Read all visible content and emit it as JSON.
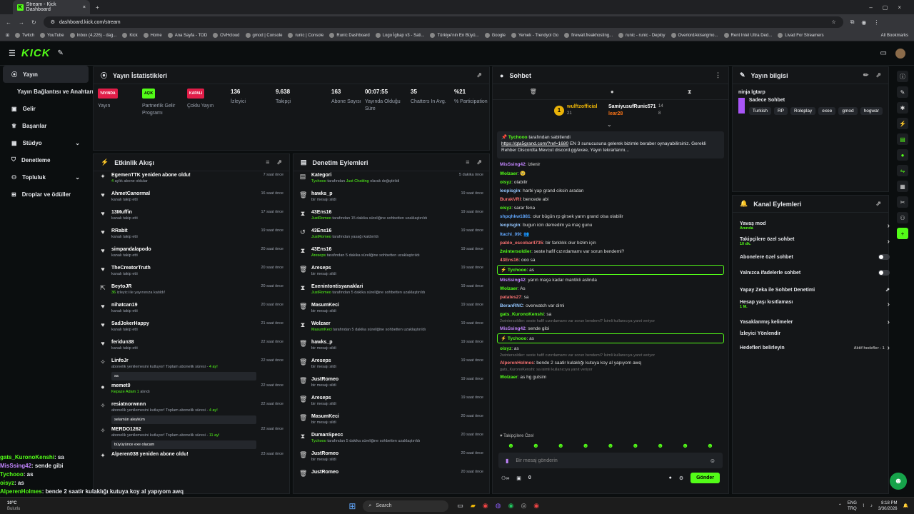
{
  "browser": {
    "tab_title": "Stream - Kick Dashboard",
    "url": "dashboard.kick.com/stream",
    "bookmarks": [
      "Twitch",
      "YouTube",
      "Inbox (4,226) - dag...",
      "Kick",
      "Home",
      "Ana Sayfa - TOD",
      "OVHcloud",
      "gmod | Console",
      "runic | Console",
      "Runic Dashboard",
      "Logo İgbap v3 - Sati...",
      "Türkiye'nin En Büyü...",
      "Google",
      "Yemek - Trendyol Go",
      "firewall.freakhosting...",
      "runic - runic - Deploy",
      "OverlordAkise/gmo...",
      "Rent Intel Ultra Ded...",
      "Livad For Streamers"
    ],
    "all_bookmarks": "All Bookmarks"
  },
  "sidebar": {
    "items": [
      {
        "label": "Yayın"
      },
      {
        "label": "Yayın Bağlantısı ve Anahtarı"
      },
      {
        "label": "Gelir"
      },
      {
        "label": "Başarılar"
      },
      {
        "label": "Stüdyo"
      },
      {
        "label": "Denetleme"
      },
      {
        "label": "Topluluk"
      },
      {
        "label": "Droplar ve ödüller"
      }
    ]
  },
  "stats": {
    "title": "Yayın İstatistikleri",
    "items": [
      {
        "badge": "YAYINDA",
        "label": "Yayın",
        "color": "#e11d48"
      },
      {
        "badge": "AÇIK",
        "label": "Partnerlik Gelir Programı",
        "color": "#53fc18"
      },
      {
        "badge": "KAPALI",
        "label": "Çoklu Yayın",
        "color": "#e11d48"
      },
      {
        "value": "136",
        "label": "İzleyici"
      },
      {
        "value": "9.638",
        "label": "Takipçi"
      },
      {
        "value": "163",
        "label": "Abone Sayısı"
      },
      {
        "value": "00:07:55",
        "label": "Yayında Olduğu Süre"
      },
      {
        "value": "35",
        "label": "Chatters In Avg."
      },
      {
        "value": "%21",
        "label": "% Participation"
      }
    ]
  },
  "activity": {
    "title": "Etkinlik Akışı",
    "items": [
      {
        "icon": "✦",
        "title": "EgemenTTK yeniden abone oldu!",
        "sub_g": "4",
        "sub": " aylık abone oldular",
        "time": "7 saat önce"
      },
      {
        "icon": "♥",
        "title": "AhmetCanormal",
        "sub": "kanalı takip etti",
        "time": "16 saat önce"
      },
      {
        "icon": "♥",
        "title": "13Muffin",
        "sub": "kanalı takip etti",
        "time": "17 saat önce"
      },
      {
        "icon": "♥",
        "title": "RRabit",
        "sub": "kanalı takip etti",
        "time": "19 saat önce"
      },
      {
        "icon": "♥",
        "title": "simpandalapodo",
        "sub": "kanalı takip etti",
        "time": "20 saat önce"
      },
      {
        "icon": "♥",
        "title": "TheCreatorTruth",
        "sub": "kanalı takip etti",
        "time": "20 saat önce"
      },
      {
        "icon": "⇱",
        "title": "BeytoJR",
        "sub_g": "36",
        "sub": " izleyici ile yayınınıza katıldı!",
        "time": "20 saat önce"
      },
      {
        "icon": "♥",
        "title": "nihatcan19",
        "sub": "kanalı takip etti",
        "time": "20 saat önce"
      },
      {
        "icon": "♥",
        "title": "SadJokerHappy",
        "sub": "kanalı takip etti",
        "time": "21 saat önce"
      },
      {
        "icon": "♥",
        "title": "feridun38",
        "sub": "kanalı takip etti",
        "time": "22 saat önce"
      },
      {
        "icon": "✧",
        "title": "LinfoJr",
        "sub": "abonelik yenilemesini kutluyor! Toplam abonelik süresi - ",
        "sub_g2": "4 ay!",
        "quote": "sa",
        "time": "22 saat önce"
      },
      {
        "icon": "●",
        "title": "memet0",
        "sub_g": "Kepaze Adam 1",
        "sub": " alındı",
        "time": "22 saat önce"
      },
      {
        "icon": "✧",
        "title": "resiatnorwnnn",
        "sub": "abonelik yenilemesini kutluyor! Toplam abonelik süresi - ",
        "sub_g2": "4 ay!",
        "quote": "selamün aleyküm",
        "time": "22 saat önce"
      },
      {
        "icon": "✧",
        "title": "MERDO1262",
        "sub": "abonelik yenilemesini kutluyor! Toplam abonelik süresi - ",
        "sub_g2": "11 ay!",
        "quote": "büyüyünce exe olacam",
        "time": "22 saat önce"
      },
      {
        "icon": "✦",
        "title": "Alperen038 yeniden abone oldu!",
        "sub": "",
        "time": "23 saat önce"
      }
    ]
  },
  "mod": {
    "title": "Denetim Eylemleri",
    "items": [
      {
        "icon": "▤",
        "title": "Kategori",
        "sub_g": "Tychooo",
        "sub": " tarafından ",
        "sub_g2": "Just Chatting",
        "sub3": " olarak değiştirildi",
        "time": "5 dakika önce"
      },
      {
        "icon": "🗑",
        "title": "hawks_p",
        "sub": "bir mesajı sildi",
        "time": "19 saat önce"
      },
      {
        "icon": "⧗",
        "title": "43Ens16",
        "sub_g": "JustRomeo",
        "sub": " tarafından 15 dakika süreliğine sohbetten uzaklaştırıldı",
        "time": "19 saat önce"
      },
      {
        "icon": "↺",
        "title": "43Ens16",
        "sub_g": "JustRomeo",
        "sub": " tarafından yasağı kaldırıldı",
        "time": "19 saat önce"
      },
      {
        "icon": "⧗",
        "title": "43Ens16",
        "sub_g": "Areseps",
        "sub": " tarafından 5 dakika süreliğine sohbetten uzaklaştırıldı",
        "time": "19 saat önce"
      },
      {
        "icon": "🗑",
        "title": "Areseps",
        "sub": "bir mesajı sildi",
        "time": "19 saat önce"
      },
      {
        "icon": "⧗",
        "title": "Exenintontisyanaklari",
        "sub_g": "JustRomeo",
        "sub": " tarafından 5 dakika süreliğine sohbetten uzaklaştırıldı",
        "time": "19 saat önce"
      },
      {
        "icon": "🗑",
        "title": "MasumKeci",
        "sub": "bir mesajı sildi",
        "time": "19 saat önce"
      },
      {
        "icon": "⧗",
        "title": "Wolzaer",
        "sub_g": "MasumKeci",
        "sub": " tarafından 5 dakika süreliğine sohbetten uzaklaştırıldı",
        "time": "19 saat önce"
      },
      {
        "icon": "🗑",
        "title": "hawks_p",
        "sub": "bir mesajı sildi",
        "time": "19 saat önce"
      },
      {
        "icon": "🗑",
        "title": "Areseps",
        "sub": "bir mesajı sildi",
        "time": "19 saat önce"
      },
      {
        "icon": "🗑",
        "title": "JustRomeo",
        "sub": "bir mesajı sildi",
        "time": "19 saat önce"
      },
      {
        "icon": "🗑",
        "title": "Areseps",
        "sub": "bir mesajı sildi",
        "time": "19 saat önce"
      },
      {
        "icon": "🗑",
        "title": "MasumKeci",
        "sub": "bir mesajı sildi",
        "time": "20 saat önce"
      },
      {
        "icon": "⧗",
        "title": "DumanSpecc",
        "sub_g": "Tychooo",
        "sub": " tarafından 5 dakika süreliğine sohbetten uzaklaştırıldı",
        "time": "20 saat önce"
      },
      {
        "icon": "🗑",
        "title": "JustRomeo",
        "sub": "bir mesajı sildi",
        "time": "20 saat önce"
      },
      {
        "icon": "🗑",
        "title": "JustRomeo",
        "sub": "",
        "time": "20 saat önce"
      }
    ]
  },
  "chat": {
    "title": "Sohbet",
    "gifter1": {
      "name": "wulftzofficial",
      "count": "21"
    },
    "gifter2": {
      "name": "SamiyusufRunic571",
      "count": "14"
    },
    "gifter3": {
      "name": "lear28",
      "count": "8"
    },
    "pinned_by": "Tychooo",
    "pinned_by_suffix": " tarafından sabitlendi",
    "pinned_link": "https://gta5grand.com/?ref=1680",
    "pinned_text": " EN 3 sunucusuna gelerek bizimle beraber oynayabilirsiniz. Gerekli Rehber Discordta Mevcut discord.gg/exee, Yayın tekrarlarını...",
    "messages": [
      {
        "name": "MisSsing42",
        "color": "#c084fc",
        "text": ": izlenir"
      },
      {
        "name": "Wolzaer",
        "color": "#53fc18",
        "text": ": 🥺"
      },
      {
        "name": "oisyz",
        "color": "#53fc18",
        "text": ": olabilir"
      },
      {
        "name": "leopisgin",
        "color": "#93c5fd",
        "text": ": harbi yap grand ciksin aradan"
      },
      {
        "name": "BurakVRI",
        "color": "#f87171",
        "text": ": bencede abi"
      },
      {
        "name": "oisyz",
        "color": "#53fc18",
        "text": ": sarar fena"
      },
      {
        "name": "shpqhkw1881",
        "color": "#60a5fa",
        "text": ": olur bügün rp girsek yarın grand olsa olabilir"
      },
      {
        "name": "leopisgin",
        "color": "#93c5fd",
        "text": ": bugun icin demedim ya maç gunu"
      },
      {
        "name": "Itachi_09I",
        "color": "#60a5fa",
        "text": ": 👥"
      },
      {
        "name": "pablo_escobar4735",
        "color": "#f87171",
        "text": ": bir farklılık olur bizim için"
      },
      {
        "name": "2wintersoldier",
        "color": "#53fc18",
        "text": ": seste hafif cızırdamamı var sorun bendemi?"
      },
      {
        "name": "43Ens16",
        "color": "#f87171",
        "text": ": ooo sa"
      },
      {
        "name": "Tychooo",
        "color": "#53fc18",
        "text": ": as",
        "hl": true
      },
      {
        "name": "MisSsing42",
        "color": "#c084fc",
        "text": ": yarın maça kadar mantikli aslinda"
      },
      {
        "name": "Wolzaer",
        "color": "#53fc18",
        "text": ": As"
      },
      {
        "name": "patates27",
        "color": "#f87171",
        "text": ": sa"
      },
      {
        "name": "BeranRNC",
        "color": "#93c5fd",
        "text": ": overwatch var dimi"
      },
      {
        "name": "gats_KuronoKenshi",
        "color": "#53fc18",
        "text": ": sa"
      },
      {
        "reply": "2wintersoldier: seste hafif cızırdamamı var sorun bendemi? İsimli kullanıcıya yanıt veriyor",
        "name": "MisSsing42",
        "color": "#c084fc",
        "text": ": sende gibi"
      },
      {
        "name": "Tychooo",
        "color": "#53fc18",
        "text": ": as",
        "hl": true
      },
      {
        "name": "oisyz",
        "color": "#53fc18",
        "text": ": as"
      },
      {
        "reply": "2wintersoldier: seste hafif cızırdamamı var sorun bendemi? İsimli kullanıcıya yanıt veriyor",
        "name": "AlperenHolmes",
        "color": "#f87171",
        "text": ": bende 2 saatir kulaklığı kutuya koy al yapıyom awq"
      },
      {
        "reply": "gats_KuronoKenshi: sa isimli kullanıcıya yanıt veriyor",
        "name": "Wolzaer",
        "color": "#53fc18",
        "text": ": as hg gutsim"
      }
    ],
    "followers_only": "Takipçilere Özel",
    "input_placeholder": "Bir mesaj gönderin",
    "points": "0",
    "send": "Gönder"
  },
  "stream_info": {
    "title": "Yayın bilgisi",
    "stream_title": "ninja lgtarp",
    "category": "Sadece Sohbet",
    "tags": [
      "Turkish",
      "RP",
      "Roleplay",
      "exee",
      "gmod",
      "hogwar"
    ]
  },
  "actions": {
    "title": "Kanal Eylemleri",
    "items": [
      {
        "label": "Yavaş mod",
        "sub": "Anında",
        "kind": "chev"
      },
      {
        "label": "Takipçilere özel sohbet",
        "sub": "10 dk.",
        "kind": "chev"
      },
      {
        "label": "Abonelere özel sohbet",
        "kind": "toggle"
      },
      {
        "label": "Yalnızca ifadelerle sohbet",
        "kind": "toggle"
      },
      {
        "label": "Yapay Zeka ile Sohbet Denetimi",
        "kind": "ext"
      },
      {
        "label": "Hesap yaşı kısıtlaması",
        "sub": "1 M.",
        "kind": "chev"
      },
      {
        "label": "Yasaklanmış kelimeler",
        "kind": "chev"
      },
      {
        "label": "İzleyici Yönlendir",
        "kind": "none"
      },
      {
        "label": "Hedefleri belirleyin",
        "kind": "goal",
        "extra": "Aktif hedefler - 1"
      }
    ]
  },
  "overlay": [
    {
      "name": "gats_KuronoKenshi",
      "text": ": sa",
      "color": "#53fc18"
    },
    {
      "name": "MisSsing42",
      "text": ": sende gibi",
      "color": "#c084fc"
    },
    {
      "name": "Tychooo",
      "text": ": as",
      "color": "#53fc18"
    },
    {
      "name": "oisyz",
      "text": ": as",
      "color": "#53fc18"
    },
    {
      "name": "AlperenHolmes",
      "text": ": bende 2 saatir kulaklığı kutuya koy al yapıyom awq",
      "color": "#53fc18"
    }
  ],
  "taskbar": {
    "weather": "10°C",
    "weather_sub": "Bulutlu",
    "search": "Search",
    "lang": "ENG",
    "lang_sub": "TRQ",
    "time": "8:18 PM",
    "date": "3/30/2026"
  }
}
